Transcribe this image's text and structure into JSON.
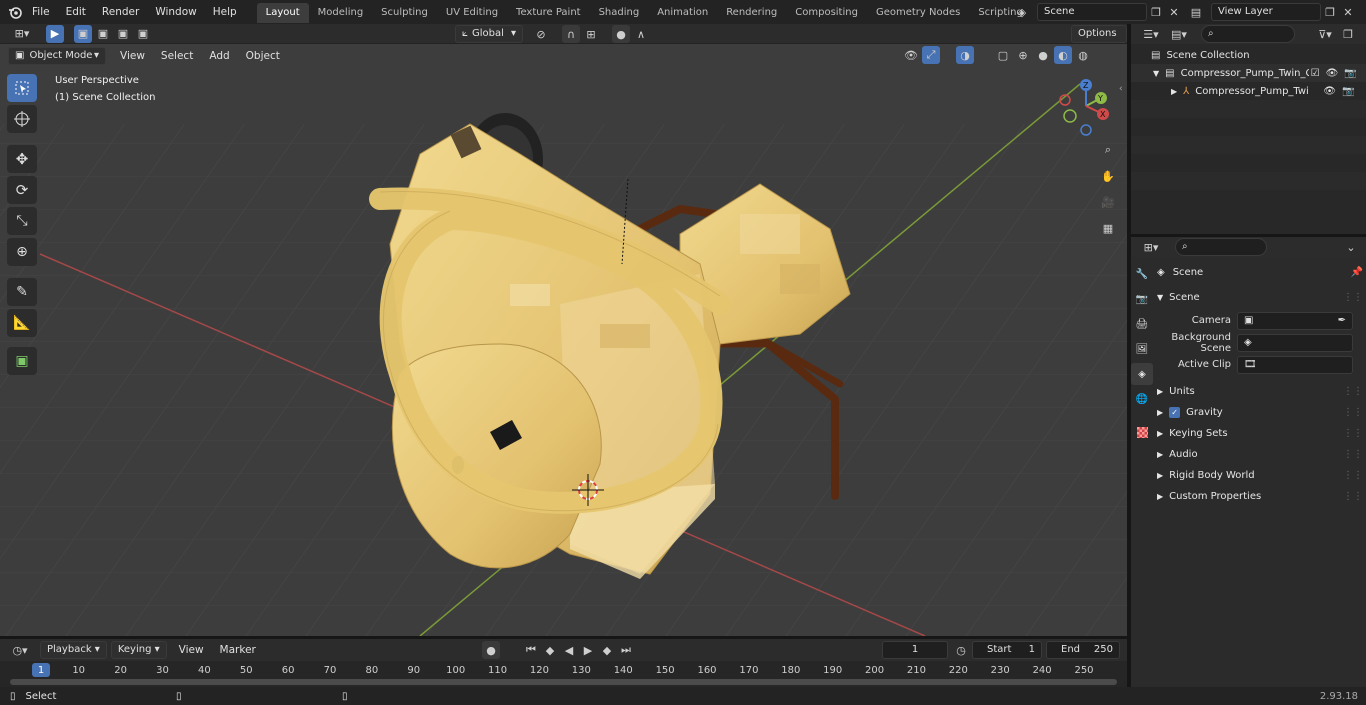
{
  "topbar": {
    "menus": [
      "File",
      "Edit",
      "Render",
      "Window",
      "Help"
    ],
    "workspaces": [
      "Layout",
      "Modeling",
      "Sculpting",
      "UV Editing",
      "Texture Paint",
      "Shading",
      "Animation",
      "Rendering",
      "Compositing",
      "Geometry Nodes",
      "Scripting"
    ],
    "active_workspace": "Layout",
    "scene_name": "Scene",
    "view_layer_name": "View Layer"
  },
  "viewport_header": {
    "mode": "Object Mode",
    "menus": [
      "View",
      "Select",
      "Add",
      "Object"
    ],
    "orientation": "Global",
    "options_label": "Options"
  },
  "viewport": {
    "perspective_label": "User Perspective",
    "collection_label": "(1) Scene Collection"
  },
  "outliner": {
    "root": "Scene Collection",
    "collection": "Compressor_Pump_Twin_Cyli",
    "object": "Compressor_Pump_Twin_"
  },
  "properties": {
    "context_title": "Scene",
    "section_title": "Scene",
    "camera_label": "Camera",
    "background_scene_label": "Background Scene",
    "active_clip_label": "Active Clip",
    "panels": [
      "Units",
      "Gravity",
      "Keying Sets",
      "Audio",
      "Rigid Body World",
      "Custom Properties"
    ],
    "gravity_checked": true
  },
  "timeline": {
    "menus": [
      "Playback",
      "Keying",
      "View",
      "Marker"
    ],
    "current_frame": "1",
    "start_label": "Start",
    "start_value": "1",
    "end_label": "End",
    "end_value": "250",
    "ruler_ticks": [
      "1",
      "10",
      "20",
      "30",
      "40",
      "50",
      "60",
      "70",
      "80",
      "90",
      "100",
      "110",
      "120",
      "130",
      "140",
      "150",
      "160",
      "170",
      "180",
      "190",
      "200",
      "210",
      "220",
      "230",
      "240",
      "250"
    ]
  },
  "statusbar": {
    "left_label": "Select",
    "version": "2.93.18"
  },
  "colors": {
    "accent": "#4772b3",
    "model_yellow": "#e8c877",
    "pipe_brown": "#5a2a10",
    "x_axis": "#b04848",
    "y_axis": "#7ea13a"
  }
}
